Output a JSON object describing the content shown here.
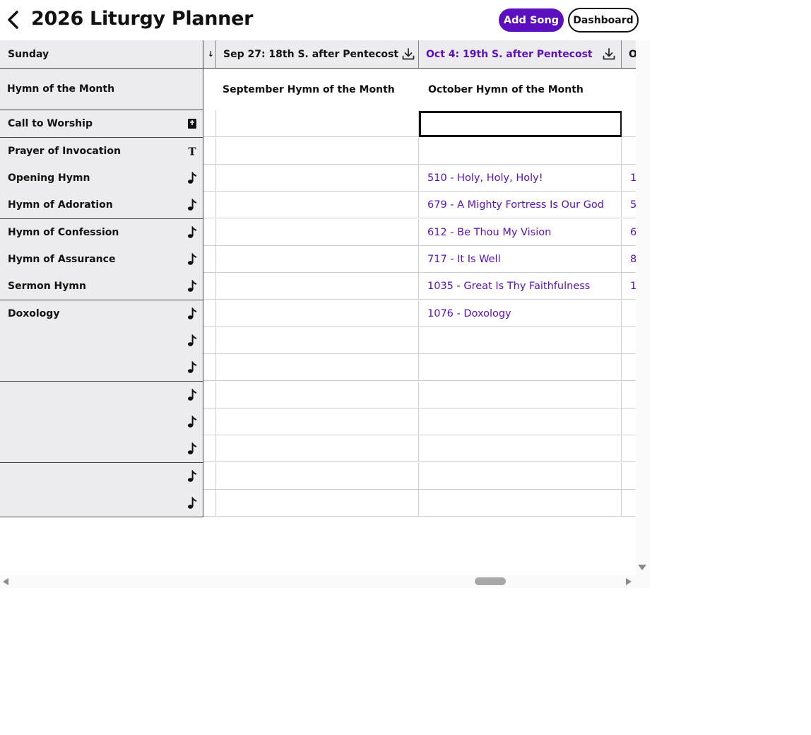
{
  "header": {
    "title": "2026 Liturgy Planner",
    "back_icon": "chevron-left-icon",
    "add_song_label": "Add Song",
    "dashboard_label": "Dashboard"
  },
  "colors": {
    "accent": "#5b0fbf",
    "row_label_bg": "#ececee",
    "border": "#444444"
  },
  "left_column": {
    "header": "Sunday",
    "hymn_of_month_label": "Hymn of the Month",
    "rows": [
      {
        "label": "Call to Worship",
        "icon": "bible-icon"
      },
      {
        "label": "Prayer of Invocation",
        "icon": "text-icon"
      },
      {
        "label": "Opening Hymn",
        "icon": "music-note-icon"
      },
      {
        "label": "Hymn of Adoration",
        "icon": "music-note-icon"
      },
      {
        "label": "Hymn of Confession",
        "icon": "music-note-icon"
      },
      {
        "label": "Hymn of Assurance",
        "icon": "music-note-icon"
      },
      {
        "label": "Sermon Hymn",
        "icon": "music-note-icon"
      },
      {
        "label": "Doxology",
        "icon": "music-note-icon"
      },
      {
        "label": "",
        "icon": "music-note-icon"
      },
      {
        "label": "",
        "icon": "music-note-icon"
      },
      {
        "label": "",
        "icon": "music-note-icon"
      },
      {
        "label": "",
        "icon": "music-note-icon"
      },
      {
        "label": "",
        "icon": "music-note-icon"
      },
      {
        "label": "",
        "icon": "music-note-icon"
      },
      {
        "label": "",
        "icon": "music-note-icon"
      }
    ]
  },
  "columns": [
    {
      "header": "",
      "hymn_of_month": "",
      "cells": [
        "",
        "",
        "",
        "",
        "",
        "",
        "",
        "",
        "",
        "",
        "",
        "",
        "",
        "",
        ""
      ]
    },
    {
      "header": "Sep 27: 18th S. after Pentecost",
      "hymn_of_month": "September Hymn of the Month",
      "cells": [
        "",
        "",
        "",
        "",
        "",
        "",
        "",
        "",
        "",
        "",
        "",
        "",
        "",
        "",
        ""
      ]
    },
    {
      "header": "Oct 4: 19th S. after Pentecost",
      "hymn_of_month": "October Hymn of the Month",
      "cells": [
        "",
        "",
        "510 - Holy, Holy, Holy!",
        "679 - A Mighty Fortress Is Our God",
        "612 - Be Thou My Vision",
        "717 - It Is Well",
        "1035 - Great Is Thy Faithfulness",
        "1076 - Doxology",
        "",
        "",
        "",
        "",
        "",
        "",
        ""
      ]
    },
    {
      "header": "O",
      "hymn_of_month": "",
      "cells": [
        "",
        "",
        "1",
        "5",
        "6",
        "8",
        "1",
        "",
        "",
        "",
        "",
        "",
        "",
        "",
        ""
      ]
    }
  ],
  "active_column": 2,
  "selected_cell": {
    "column": 2,
    "row": 0
  }
}
